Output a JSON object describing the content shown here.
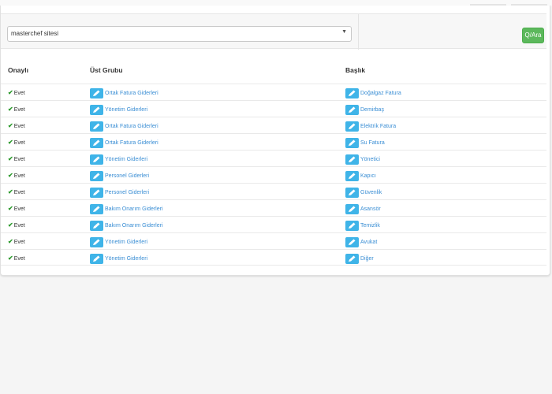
{
  "filter": {
    "selected": "masterchef sitesi",
    "search_label": "Q/Ara"
  },
  "table": {
    "headers": [
      "Onaylı",
      "Üst Grubu",
      "Başlık"
    ],
    "rows": [
      {
        "onayli": "Evet",
        "ust_grubu": "Ortak Fatura Giderleri",
        "baslik": "Doğalgaz Fatura"
      },
      {
        "onayli": "Evet",
        "ust_grubu": "Yönetim Giderleri",
        "baslik": "Demirbaş"
      },
      {
        "onayli": "Evet",
        "ust_grubu": "Ortak Fatura Giderleri",
        "baslik": "Elektrik Fatura"
      },
      {
        "onayli": "Evet",
        "ust_grubu": "Ortak Fatura Giderleri",
        "baslik": "Su Fatura"
      },
      {
        "onayli": "Evet",
        "ust_grubu": "Yönetim Giderleri",
        "baslik": "Yönetici"
      },
      {
        "onayli": "Evet",
        "ust_grubu": "Personel Giderleri",
        "baslik": "Kapıcı"
      },
      {
        "onayli": "Evet",
        "ust_grubu": "Personel Giderleri",
        "baslik": "Güvenlik"
      },
      {
        "onayli": "Evet",
        "ust_grubu": "Bakım Onarım Giderleri",
        "baslik": "Asansör"
      },
      {
        "onayli": "Evet",
        "ust_grubu": "Bakım Onarım Giderleri",
        "baslik": "Temizlik"
      },
      {
        "onayli": "Evet",
        "ust_grubu": "Yönetim Giderleri",
        "baslik": "Avukat"
      },
      {
        "onayli": "Evet",
        "ust_grubu": "Yönetim Giderleri",
        "baslik": "Diğer"
      }
    ]
  },
  "icons": {
    "approved": "check-icon",
    "edit": "pencil-icon",
    "dropdown": "chevron-down-icon"
  },
  "colors": {
    "accent": "#3fb4e8",
    "link": "#3a8ed4",
    "success": "#5cb85c",
    "check": "#2c9a2c"
  }
}
